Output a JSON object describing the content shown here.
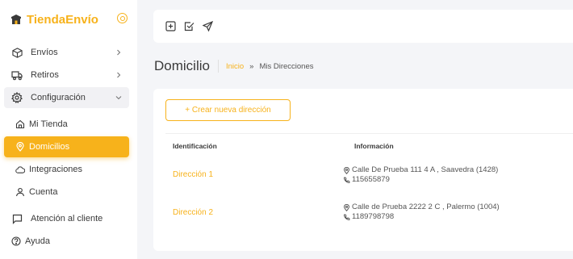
{
  "brand": {
    "name": "TiendaEnvío"
  },
  "nav": {
    "envios": "Envíos",
    "retiros": "Retiros",
    "configuracion": "Configuración",
    "mi_tienda": "Mi Tienda",
    "domicilios": "Domicilios",
    "integraciones": "Integraciones",
    "cuenta": "Cuenta",
    "atencion": "Atención al cliente",
    "ayuda": "Ayuda"
  },
  "page": {
    "title": "Domicilio",
    "breadcrumb_home": "Inicio",
    "breadcrumb_separator": "»",
    "breadcrumb_current": "Mis Direcciones"
  },
  "card": {
    "create_button": "+ Crear nueva dirección",
    "columns": {
      "id": "Identificación",
      "info": "Información"
    },
    "rows": [
      {
        "id": "Dirección 1",
        "address": "Calle De Prueba 111 4 A , Saavedra (1428)",
        "phone": "115655879"
      },
      {
        "id": "Dirección 2",
        "address": "Calle de Prueba 2222 2 C , Palermo (1004)",
        "phone": "1189798798"
      }
    ]
  },
  "colors": {
    "accent": "#f7b21b",
    "background": "#f4f5f8",
    "surface": "#ffffff"
  },
  "icons": [
    "shop-icon",
    "settings-ring-icon",
    "box-icon",
    "truck-icon",
    "gear-icon",
    "home-icon",
    "pin-icon",
    "cloud-icon",
    "user-icon",
    "chat-icon",
    "help-icon",
    "plus-square-icon",
    "check-square-icon",
    "send-icon",
    "phone-icon"
  ]
}
